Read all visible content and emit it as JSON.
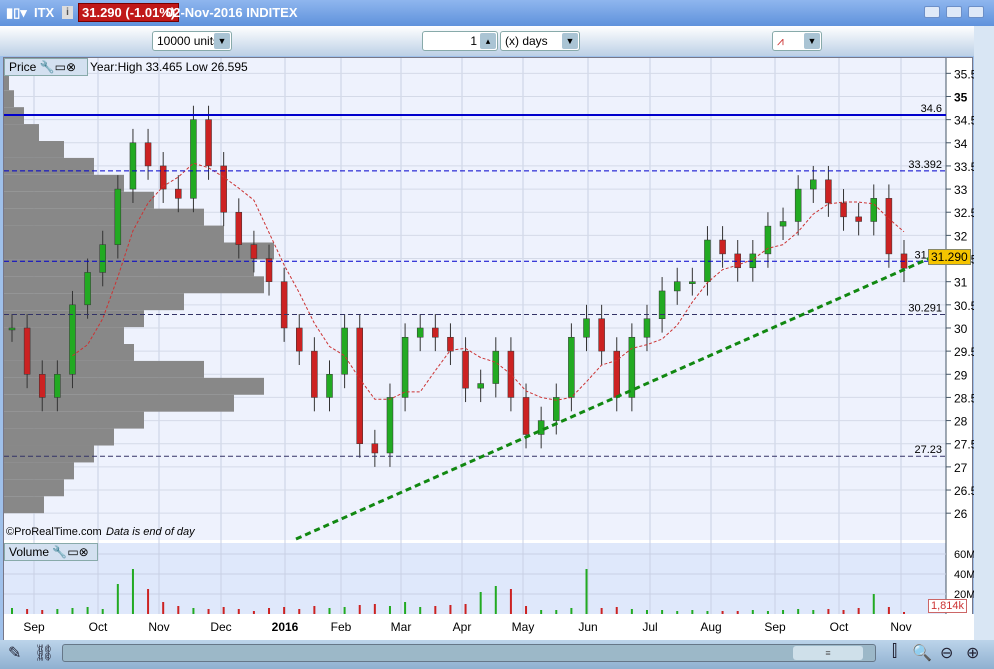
{
  "header": {
    "symbol": "ITX",
    "price_change": "31.290 (-1.01%)",
    "date_name": "02-Nov-2016 INDITEX"
  },
  "toolbar": {
    "units": "10000 units",
    "period_value": "1",
    "period_unit": "(x) days"
  },
  "price_panel": {
    "label": "Price",
    "stats": "Year:High 33.465 Low 26.595",
    "copyright": "©ProRealTime.com",
    "note": "Data is end of day",
    "current_price": "31.290",
    "levels": [
      {
        "value": 34.6,
        "label": "34.6",
        "style": "solid",
        "color": "#0000cc"
      },
      {
        "value": 33.392,
        "label": "33.392",
        "style": "dashed",
        "color": "#0000cc"
      },
      {
        "value": 31.44,
        "label": "31.44",
        "style": "dashed",
        "color": "#0000cc"
      },
      {
        "value": 30.291,
        "label": "30.291",
        "style": "dashed",
        "color": "#333366"
      },
      {
        "value": 27.23,
        "label": "27.23",
        "style": "dashed",
        "color": "#333366"
      }
    ],
    "y_ticks": [
      "35.5",
      "35",
      "34.5",
      "34",
      "33.5",
      "33",
      "32.5",
      "32",
      "31.5",
      "31",
      "30.5",
      "30",
      "29.5",
      "29",
      "28.5",
      "28",
      "27.5",
      "27",
      "26.5",
      "26"
    ]
  },
  "volume_panel": {
    "label": "Volume",
    "y_ticks": [
      "60M",
      "40M",
      "20M"
    ],
    "current_volume": "1,814k"
  },
  "x_ticks": [
    "Sep",
    "Oct",
    "Nov",
    "Dec",
    "2016",
    "Feb",
    "Mar",
    "Apr",
    "May",
    "Jun",
    "Jul",
    "Aug",
    "Sep",
    "Oct",
    "Nov"
  ],
  "chart_data": {
    "type": "candlestick",
    "ylim": [
      25.5,
      35.7
    ],
    "closes": [
      30,
      29,
      28.5,
      29,
      30.5,
      31.2,
      31.8,
      33,
      34,
      33.5,
      33,
      32.8,
      34.5,
      33.5,
      32.5,
      31.8,
      31.5,
      31,
      30,
      29.5,
      28.5,
      29,
      30,
      27.5,
      27.3,
      28.5,
      29.8,
      30,
      29.8,
      29.5,
      28.7,
      28.8,
      29.5,
      28.5,
      27.7,
      28,
      28.5,
      29.8,
      30.2,
      29.5,
      28.5,
      29.8,
      30.2,
      30.8,
      31,
      31,
      31.9,
      31.6,
      31.3,
      31.6,
      32.2,
      32.3,
      33,
      33.2,
      32.7,
      32.4,
      32.3,
      32.8,
      31.6,
      31.29
    ],
    "volumes_m": [
      6,
      5,
      4,
      5,
      6,
      7,
      5,
      30,
      45,
      25,
      12,
      8,
      6,
      5,
      7,
      5,
      3,
      6,
      7,
      5,
      8,
      6,
      7,
      9,
      10,
      8,
      12,
      7,
      8,
      9,
      10,
      22,
      28,
      25,
      8,
      4,
      4,
      6,
      45,
      6,
      7,
      5,
      4,
      4,
      3,
      4,
      3,
      3,
      3,
      4,
      3,
      4,
      5,
      4,
      5,
      4,
      6,
      20,
      7,
      2
    ],
    "colors": {
      "up": "#22aa22",
      "down": "#cc2222",
      "trend": "#118811"
    }
  },
  "volume_profile": [
    5,
    10,
    20,
    35,
    60,
    90,
    120,
    150,
    200,
    220,
    270,
    250,
    260,
    180,
    140,
    120,
    130,
    200,
    260,
    230,
    140,
    110,
    90,
    70,
    60,
    40
  ]
}
